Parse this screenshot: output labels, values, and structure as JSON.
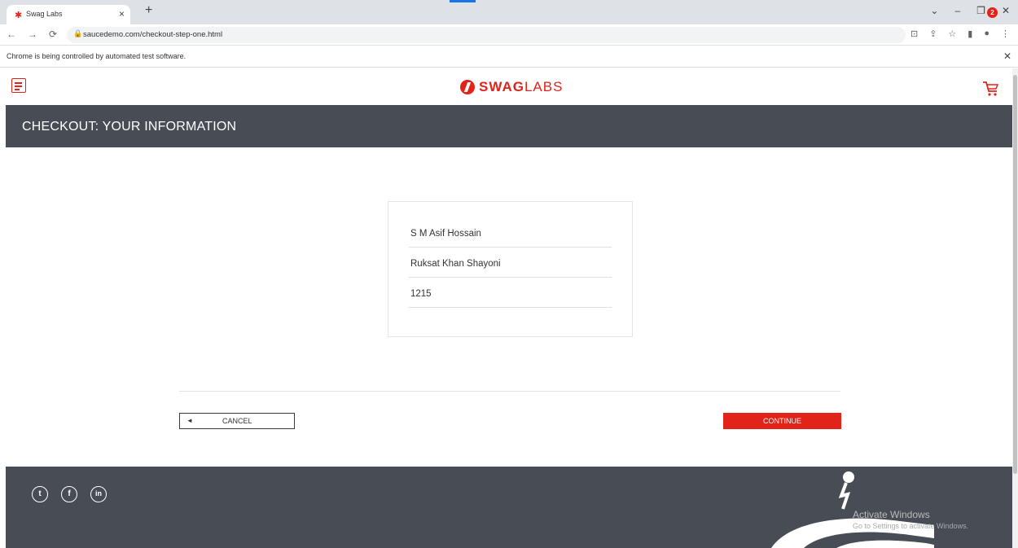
{
  "browser": {
    "tab_title": "Swag Labs",
    "url": "saucedemo.com/checkout-step-one.html",
    "infobar_text": "Chrome is being controlled by automated test software."
  },
  "header": {
    "logo_bold": "SWAG",
    "logo_light": "LABS",
    "cart_count": "2"
  },
  "page": {
    "title": "CHECKOUT: YOUR INFORMATION"
  },
  "form": {
    "first_name": "S M Asif Hossain",
    "last_name": "Ruksat Khan Shayoni",
    "postal_code": "1215"
  },
  "actions": {
    "cancel_label": "CANCEL",
    "continue_label": "CONTINUE"
  },
  "watermark": {
    "title": "Activate Windows",
    "subtitle": "Go to Settings to activate Windows."
  },
  "colors": {
    "accent": "#e2231a",
    "dark_bar": "#474c55"
  }
}
